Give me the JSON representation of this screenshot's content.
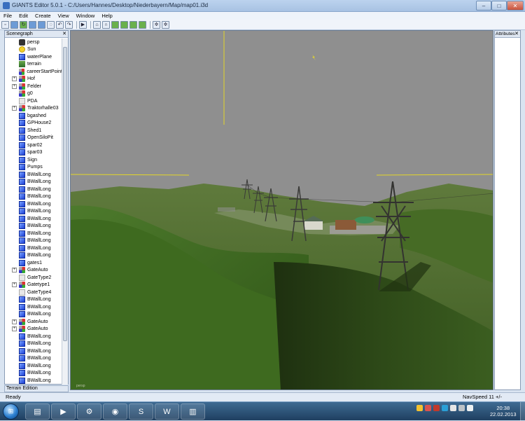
{
  "window": {
    "title": "GIANTS Editor 5.0.1 - C:/Users/Hannes/Desktop/Niederbayern/Map/map01.i3d",
    "minimize": "–",
    "maximize": "□",
    "close": "✕"
  },
  "menu": [
    "File",
    "Edit",
    "Create",
    "View",
    "Window",
    "Help"
  ],
  "toolbar": {
    "icons": [
      "new-icon",
      "open-icon",
      "reload-icon",
      "save-icon",
      "save-as-icon",
      "lasso-icon",
      "undo-icon",
      "redo-icon",
      "play-icon",
      "select-icon",
      "magnet-icon",
      "terrain-sculpt-icon",
      "terrain-paint-icon",
      "foliage-paint-icon",
      "grass-paint-icon",
      "settings-icon",
      "settings-alt-icon"
    ]
  },
  "scenegraph": {
    "title": "Scenegraph",
    "close": "✕",
    "nodes": [
      {
        "label": "persp",
        "icon": "camera",
        "expander": ""
      },
      {
        "label": "Sun",
        "icon": "sun",
        "expander": ""
      },
      {
        "label": "waterPlane",
        "icon": "cube",
        "expander": ""
      },
      {
        "label": "terrain",
        "icon": "terrain",
        "expander": ""
      },
      {
        "label": "careerStartPoint",
        "icon": "group",
        "expander": ""
      },
      {
        "label": "Hof",
        "icon": "group",
        "expander": "+"
      },
      {
        "label": "Felder",
        "icon": "group",
        "expander": "+"
      },
      {
        "label": "g0",
        "icon": "group",
        "expander": ""
      },
      {
        "label": "PDA",
        "icon": "light",
        "expander": ""
      },
      {
        "label": "Traktorhalle03",
        "icon": "group",
        "expander": "+"
      },
      {
        "label": "bgashed",
        "icon": "cube",
        "expander": ""
      },
      {
        "label": "GPHouse2",
        "icon": "cube",
        "expander": ""
      },
      {
        "label": "Shed1",
        "icon": "cube",
        "expander": ""
      },
      {
        "label": "OpenSiloPit",
        "icon": "cube",
        "expander": ""
      },
      {
        "label": "spar02",
        "icon": "cube",
        "expander": ""
      },
      {
        "label": "spar03",
        "icon": "cube",
        "expander": ""
      },
      {
        "label": "Sign",
        "icon": "cube",
        "expander": ""
      },
      {
        "label": "Pumps",
        "icon": "cube",
        "expander": ""
      },
      {
        "label": "BWallLong",
        "icon": "cube",
        "expander": ""
      },
      {
        "label": "BWallLong",
        "icon": "cube",
        "expander": ""
      },
      {
        "label": "BWallLong",
        "icon": "cube",
        "expander": ""
      },
      {
        "label": "BWallLong",
        "icon": "cube",
        "expander": ""
      },
      {
        "label": "BWallLong",
        "icon": "cube",
        "expander": ""
      },
      {
        "label": "BWallLong",
        "icon": "cube",
        "expander": ""
      },
      {
        "label": "BWallLong",
        "icon": "cube",
        "expander": ""
      },
      {
        "label": "BWallLong",
        "icon": "cube",
        "expander": ""
      },
      {
        "label": "BWallLong",
        "icon": "cube",
        "expander": ""
      },
      {
        "label": "BWallLong",
        "icon": "cube",
        "expander": ""
      },
      {
        "label": "BWallLong",
        "icon": "cube",
        "expander": ""
      },
      {
        "label": "BWallLong",
        "icon": "cube",
        "expander": ""
      },
      {
        "label": "gates1",
        "icon": "cube",
        "expander": ""
      },
      {
        "label": "GateAuto",
        "icon": "group",
        "expander": "+"
      },
      {
        "label": "GateType2",
        "icon": "light",
        "expander": ""
      },
      {
        "label": "Gatetype1",
        "icon": "group",
        "expander": "+"
      },
      {
        "label": "GateType4",
        "icon": "light",
        "expander": ""
      },
      {
        "label": "BWallLong",
        "icon": "cube",
        "expander": ""
      },
      {
        "label": "BWallLong",
        "icon": "cube",
        "expander": ""
      },
      {
        "label": "BWallLong",
        "icon": "cube",
        "expander": ""
      },
      {
        "label": "GateAuto",
        "icon": "group",
        "expander": "+"
      },
      {
        "label": "GateAuto",
        "icon": "group",
        "expander": "+"
      },
      {
        "label": "BWallLong",
        "icon": "cube",
        "expander": ""
      },
      {
        "label": "BWallLong",
        "icon": "cube",
        "expander": ""
      },
      {
        "label": "BWallLong",
        "icon": "cube",
        "expander": ""
      },
      {
        "label": "BWallLong",
        "icon": "cube",
        "expander": ""
      },
      {
        "label": "BWallLong",
        "icon": "cube",
        "expander": ""
      },
      {
        "label": "BWallLong",
        "icon": "cube",
        "expander": ""
      },
      {
        "label": "BWallLong",
        "icon": "cube",
        "expander": ""
      }
    ]
  },
  "terrain_edition": {
    "title": "Terrain Edition"
  },
  "attributes": {
    "title": "Attributes",
    "close": "✕"
  },
  "viewport": {
    "camera_label": "persp"
  },
  "status": {
    "ready": "Ready",
    "navspeed": "NavSpeed 11 +/-"
  },
  "taskbar": {
    "apps": [
      "explorer-icon",
      "media-player-icon",
      "giants-editor-icon",
      "firefox-icon",
      "skype-icon",
      "word-icon",
      "archive-icon"
    ],
    "time": "20:38",
    "date": "22.02.2013"
  }
}
